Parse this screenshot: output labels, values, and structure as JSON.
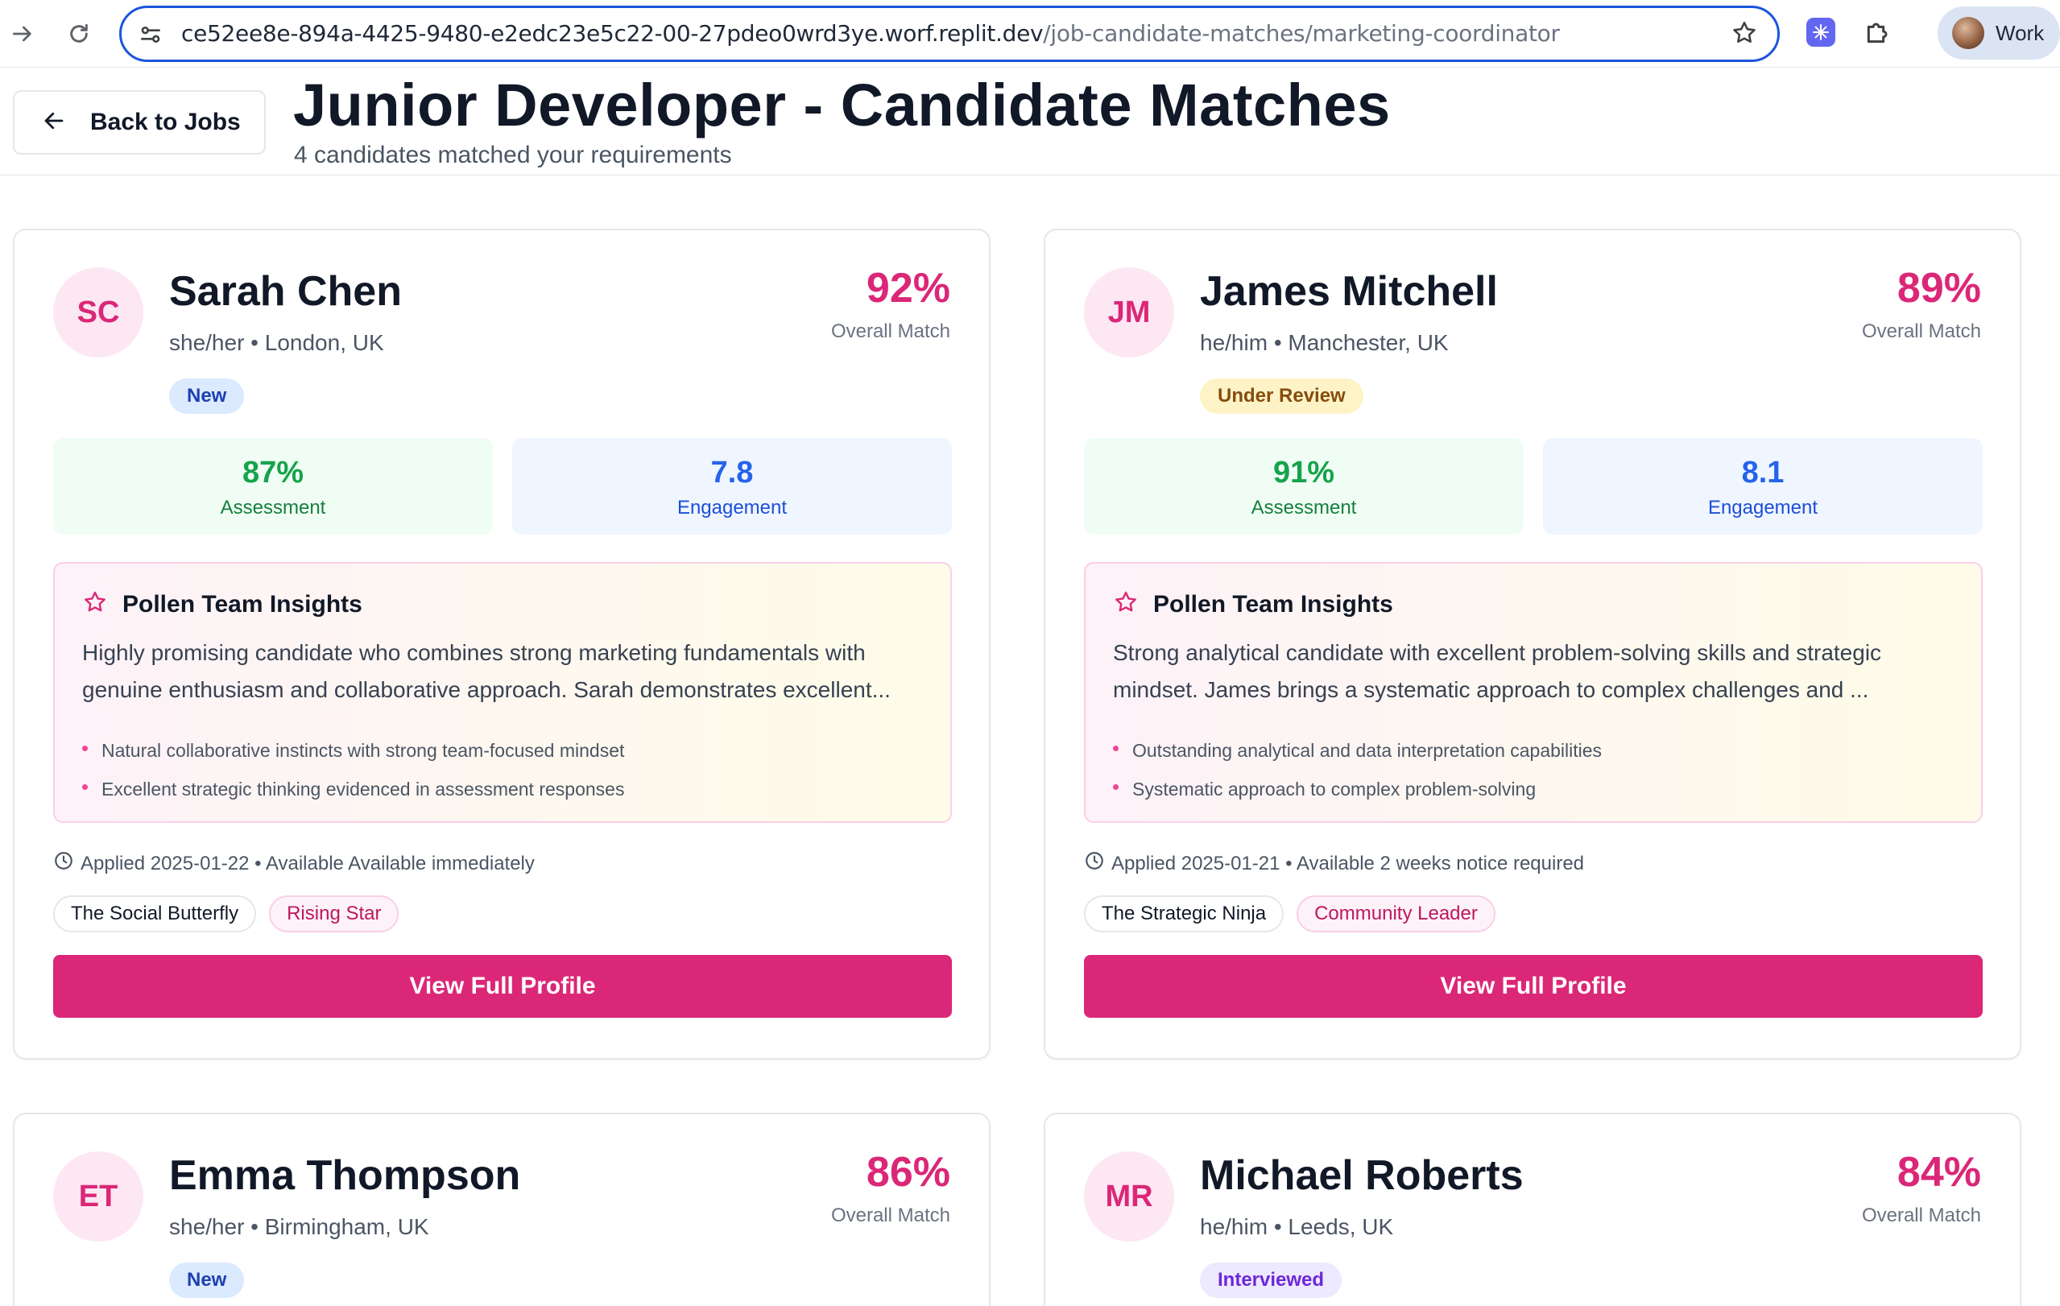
{
  "browser": {
    "url_host": "ce52ee8e-894a-4425-9480-e2edc23e5c22-00-27pdeo0wrd3ye.worf.replit.dev",
    "url_path": "/job-candidate-matches/marketing-coordinator",
    "profile_label": "Work"
  },
  "header": {
    "back_label": "Back to Jobs",
    "title": "Junior Developer - Candidate Matches",
    "subtitle": "4 candidates matched your requirements"
  },
  "labels": {
    "overall_match": "Overall Match",
    "assessment": "Assessment",
    "engagement": "Engagement",
    "insights_title": "Pollen Team Insights",
    "view_profile": "View Full Profile"
  },
  "candidates": [
    {
      "initials": "SC",
      "name": "Sarah Chen",
      "meta": "she/her • London, UK",
      "match": "92%",
      "status": "New",
      "assessment": "87%",
      "engagement": "7.8",
      "insight": "Highly promising candidate who combines strong marketing fundamentals with genuine enthusiasm and collaborative approach. Sarah demonstrates excellent...",
      "points": [
        "Natural collaborative instincts with strong team-focused mindset",
        "Excellent strategic thinking evidenced in assessment responses"
      ],
      "applied": "Applied 2025-01-22 • Available Available immediately",
      "tags": [
        "The Social Butterfly",
        "Rising Star"
      ]
    },
    {
      "initials": "JM",
      "name": "James Mitchell",
      "meta": "he/him • Manchester, UK",
      "match": "89%",
      "status": "Under Review",
      "assessment": "91%",
      "engagement": "8.1",
      "insight": "Strong analytical candidate with excellent problem-solving skills and strategic mindset. James brings a systematic approach to complex challenges and ...",
      "points": [
        "Outstanding analytical and data interpretation capabilities",
        "Systematic approach to complex problem-solving"
      ],
      "applied": "Applied 2025-01-21 • Available 2 weeks notice required",
      "tags": [
        "The Strategic Ninja",
        "Community Leader"
      ]
    },
    {
      "initials": "ET",
      "name": "Emma Thompson",
      "meta": "she/her • Birmingham, UK",
      "match": "86%",
      "status": "New"
    },
    {
      "initials": "MR",
      "name": "Michael Roberts",
      "meta": "he/him • Leeds, UK",
      "match": "84%",
      "status": "Interviewed"
    }
  ]
}
